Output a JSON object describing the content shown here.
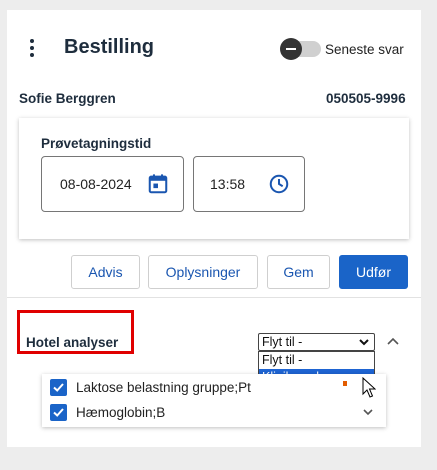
{
  "header": {
    "title": "Bestilling",
    "toggle_label": "Seneste svar"
  },
  "patient": {
    "name": "Sofie Berggren",
    "id": "050505-9996"
  },
  "sampling": {
    "label": "Prøvetagningstid",
    "date": "08-08-2024",
    "time": "13:58"
  },
  "actions": {
    "advis": "Advis",
    "oplysninger": "Oplysninger",
    "gem": "Gem",
    "udfor": "Udfør"
  },
  "section": {
    "title": "Hotel analyser",
    "move_select": {
      "selected": "Flyt til -",
      "options": [
        "Flyt til -",
        "Klinik analyser"
      ],
      "highlighted_index": 1
    }
  },
  "analyses": [
    {
      "label": "Laktose belastning gruppe;Pt",
      "checked": true
    },
    {
      "label": "Hæmoglobin;B",
      "checked": true
    }
  ],
  "colors": {
    "accent": "#1a64c8",
    "highlight_border": "#e00000"
  },
  "icons": {
    "menu": "kebab-menu-icon",
    "calendar": "calendar-icon",
    "clock": "clock-icon",
    "collapse": "chevron-up-icon",
    "expand": "chevron-down-icon"
  }
}
